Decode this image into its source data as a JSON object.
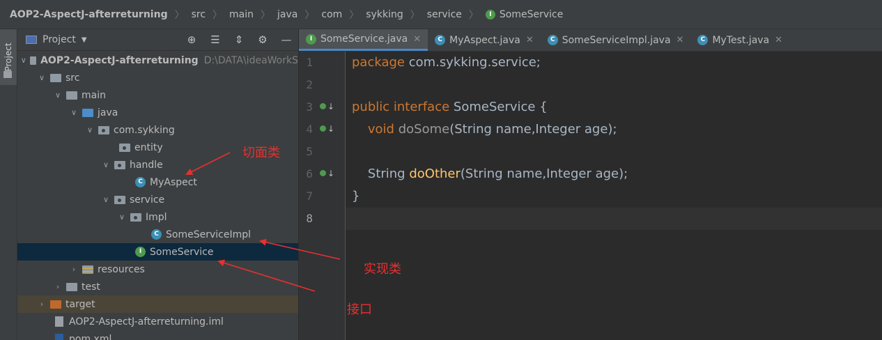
{
  "breadcrumb": [
    "AOP2-AspectJ-afterreturning",
    "src",
    "main",
    "java",
    "com",
    "sykking",
    "service",
    "SomeService"
  ],
  "breadcrumb_icon": "I",
  "sidebar_tab": "Project",
  "project_header": {
    "label": "Project"
  },
  "tree": [
    {
      "label": "AOP2-AspectJ-afterreturning",
      "path": "D:\\DATA\\ideaWorkS"
    },
    {
      "label": "src"
    },
    {
      "label": "main"
    },
    {
      "label": "java"
    },
    {
      "label": "com.sykking"
    },
    {
      "label": "entity"
    },
    {
      "label": "handle"
    },
    {
      "label": "MyAspect",
      "icon": "C"
    },
    {
      "label": "service"
    },
    {
      "label": "Impl"
    },
    {
      "label": "SomeServiceImpl",
      "icon": "C"
    },
    {
      "label": "SomeService",
      "icon": "I"
    },
    {
      "label": "resources"
    },
    {
      "label": "test"
    },
    {
      "label": "target"
    },
    {
      "label": "AOP2-AspectJ-afterreturning.iml"
    },
    {
      "label": "pom.xml"
    }
  ],
  "tabs": [
    {
      "label": "SomeService.java",
      "icon": "I",
      "active": true
    },
    {
      "label": "MyAspect.java",
      "icon": "C"
    },
    {
      "label": "SomeServiceImpl.java",
      "icon": "C"
    },
    {
      "label": "MyTest.java",
      "icon": "C"
    }
  ],
  "line_numbers": [
    "1",
    "2",
    "3",
    "4",
    "5",
    "6",
    "7",
    "8"
  ],
  "code": {
    "l1_kw": "package",
    "l1_rest": " com.sykking.service;",
    "l3_kw1": "public",
    "l3_kw2": " interface",
    "l3_rest": " SomeService {",
    "l4_kw": "    void",
    "l4_fn": " doSome",
    "l4_rest": "(String name,Integer age);",
    "l6_type": "    String",
    "l6_fn": " doOther",
    "l6_rest": "(String name,Integer age);",
    "l7": "}"
  },
  "annotations": {
    "aspect": "切面类",
    "impl": "实现类",
    "interface": "接口"
  },
  "colors": {
    "annotation": "#e8302f",
    "keyword": "#cc7832",
    "method": "#ffc66d",
    "selection": "#0d293e"
  }
}
